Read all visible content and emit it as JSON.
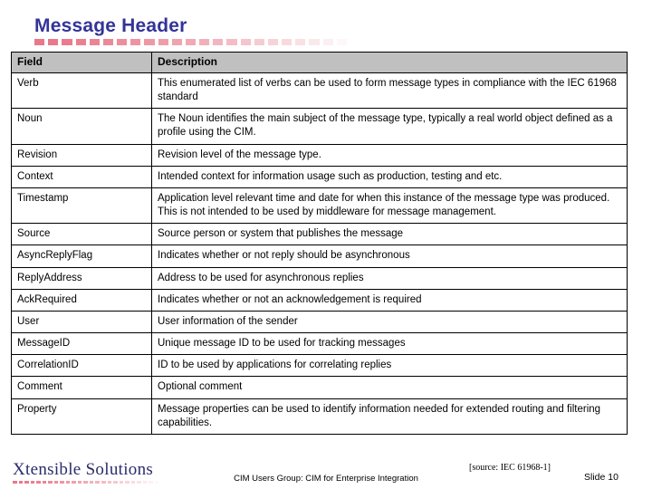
{
  "slide": {
    "title": "Message Header"
  },
  "table": {
    "columns": [
      "Field",
      "Description"
    ],
    "rows": [
      {
        "field": "Verb",
        "description": "This enumerated list of verbs can be used to form message types in compliance with the IEC 61968 standard"
      },
      {
        "field": "Noun",
        "description": "The Noun identifies the main subject of the message type, typically a real world object defined as a profile using the CIM."
      },
      {
        "field": "Revision",
        "description": "Revision level of the message type."
      },
      {
        "field": "Context",
        "description": "Intended context for information usage such as production, testing and etc."
      },
      {
        "field": "Timestamp",
        "description": "Application level relevant time and date for when this instance of the message type was produced.  This is not intended to be used by middleware for message management."
      },
      {
        "field": "Source",
        "description": "Source person or system that publishes the message"
      },
      {
        "field": "AsyncReplyFlag",
        "description": "Indicates whether or not reply should be asynchronous"
      },
      {
        "field": "ReplyAddress",
        "description": "Address to be used for asynchronous replies"
      },
      {
        "field": "AckRequired",
        "description": "Indicates whether or not an acknowledgement is required"
      },
      {
        "field": "User",
        "description": "User information of the sender"
      },
      {
        "field": "MessageID",
        "description": "Unique message ID to be used for tracking messages"
      },
      {
        "field": "CorrelationID",
        "description": "ID to be used by applications for correlating replies"
      },
      {
        "field": "Comment",
        "description": "Optional comment"
      },
      {
        "field": "Property",
        "description": "Message properties can be used to identify information needed for extended routing and filtering capabilities."
      }
    ]
  },
  "footer": {
    "logo_text": "Xtensible Solutions",
    "center_text": "CIM Users Group: CIM for Enterprise Integration",
    "source_note": "[source: IEC 61968-1]",
    "slide_number": "Slide 10"
  },
  "colors": {
    "title": "#333399",
    "accent_dash": "#e8788a",
    "header_row_bg": "#c0c0c0",
    "logo": "#2b2b6b",
    "background": "#ffffff"
  }
}
